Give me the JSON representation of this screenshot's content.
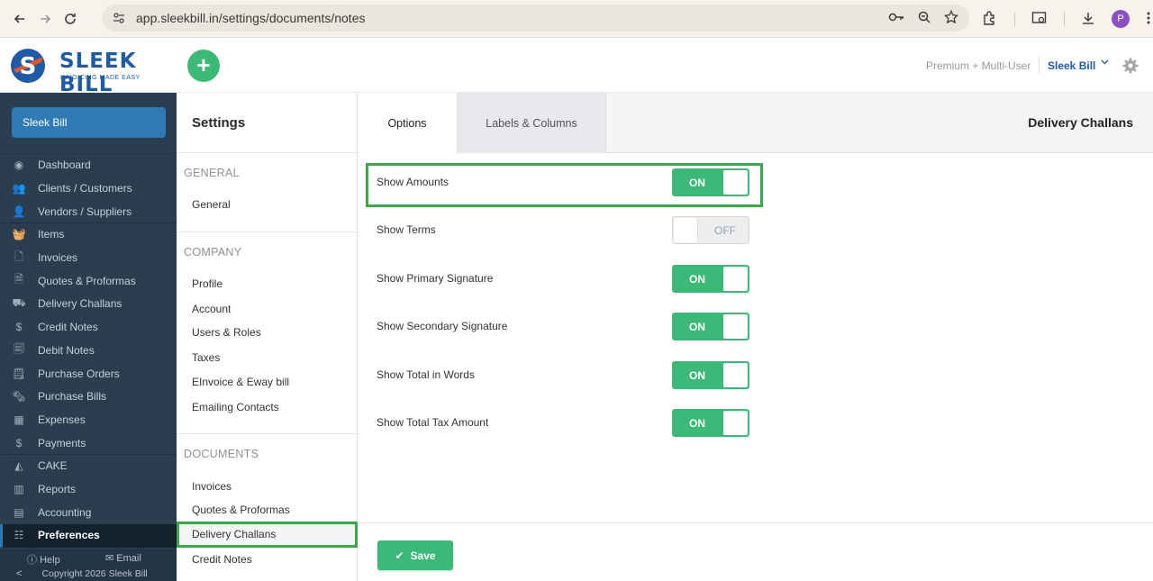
{
  "browser": {
    "url": "app.sleekbill.in/settings/documents/notes",
    "profile_initial": "P"
  },
  "header": {
    "logo_text": "SLEEK BILL",
    "logo_tagline": "INVOICING MADE EASY",
    "add_label": "+",
    "plan": "Premium + Multi-User",
    "user": "Sleek Bill"
  },
  "leftnav": {
    "company": "Sleek Bill",
    "items": [
      {
        "label": "Dashboard",
        "icon": "eye-icon",
        "glyph": "◉"
      },
      {
        "label": "Clients / Customers",
        "icon": "clients-icon",
        "glyph": "👥"
      },
      {
        "label": "Vendors / Suppliers",
        "icon": "vendors-icon",
        "glyph": "👤"
      },
      {
        "label": "Items",
        "icon": "basket-icon",
        "glyph": "🧺"
      },
      {
        "label": "Invoices",
        "icon": "invoice-icon",
        "glyph": "🗋"
      },
      {
        "label": "Quotes & Proformas",
        "icon": "quote-icon",
        "glyph": "🗎"
      },
      {
        "label": "Delivery Challans",
        "icon": "truck-icon",
        "glyph": "⛟"
      },
      {
        "label": "Credit Notes",
        "icon": "credit-note-icon",
        "glyph": "$"
      },
      {
        "label": "Debit Notes",
        "icon": "debit-note-icon",
        "glyph": "🗐"
      },
      {
        "label": "Purchase Orders",
        "icon": "purchase-order-icon",
        "glyph": "🗒"
      },
      {
        "label": "Purchase Bills",
        "icon": "purchase-bill-icon",
        "glyph": "🗞"
      },
      {
        "label": "Expenses",
        "icon": "calculator-icon",
        "glyph": "▦"
      },
      {
        "label": "Payments",
        "icon": "dollar-icon",
        "glyph": "$"
      },
      {
        "label": "CAKE",
        "icon": "cake-icon",
        "glyph": "◭"
      },
      {
        "label": "Reports",
        "icon": "chart-icon",
        "glyph": "▥"
      },
      {
        "label": "Accounting",
        "icon": "accounting-icon",
        "glyph": "▤"
      },
      {
        "label": "Preferences",
        "icon": "sliders-icon",
        "glyph": "☷"
      }
    ],
    "help": "Help",
    "email": "Email",
    "copyright": "Copyright 2026 Sleek Bill"
  },
  "settings": {
    "title": "Settings",
    "groups": [
      {
        "title": "GENERAL",
        "items": [
          "General"
        ]
      },
      {
        "title": "COMPANY",
        "items": [
          "Profile",
          "Account",
          "Users & Roles",
          "Taxes",
          "EInvoice & Eway bill",
          "Emailing Contacts"
        ]
      },
      {
        "title": "DOCUMENTS",
        "items": [
          "Invoices",
          "Quotes & Proformas",
          "Delivery Challans",
          "Credit Notes"
        ]
      }
    ]
  },
  "main": {
    "tabs": [
      "Options",
      "Labels & Columns"
    ],
    "page_title": "Delivery Challans",
    "options": [
      {
        "label": "Show Amounts",
        "state": "ON"
      },
      {
        "label": "Show Terms",
        "state": "OFF"
      },
      {
        "label": "Show Primary Signature",
        "state": "ON"
      },
      {
        "label": "Show Secondary Signature",
        "state": "ON"
      },
      {
        "label": "Show Total in Words",
        "state": "ON"
      },
      {
        "label": "Show Total Tax Amount",
        "state": "ON"
      }
    ],
    "save_label": "Save"
  },
  "colors": {
    "accent_green": "#3cb878",
    "highlight_green": "#3da84a",
    "nav_bg": "#2a3e4f",
    "brand_blue": "#1f5aa6"
  }
}
